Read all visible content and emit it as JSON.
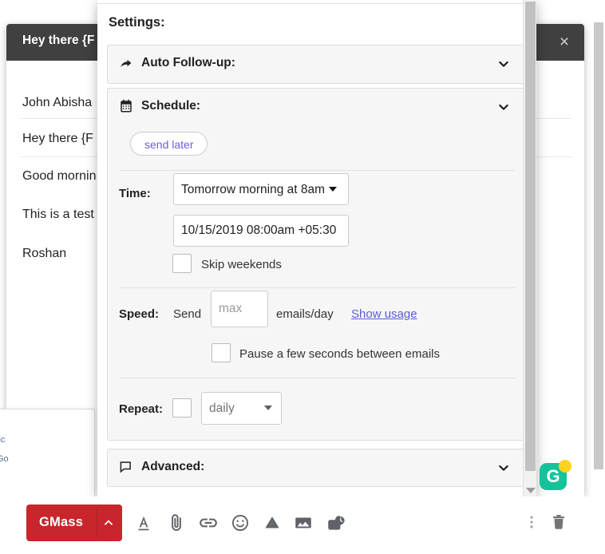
{
  "compose": {
    "subject": "Hey there {F",
    "close_label": "×",
    "rows": [
      "John Abisha",
      "Hey there {F",
      "Good mornin",
      "This is a test",
      "Roshan"
    ]
  },
  "left_peek": {
    "lines": [
      "lic",
      "Go"
    ]
  },
  "settings": {
    "title": "Settings:",
    "sections": {
      "auto_followup": {
        "label": "Auto Follow-up:",
        "icon": "forward-arrow-icon",
        "chevron": "chevron-down-icon"
      },
      "schedule": {
        "label": "Schedule:",
        "icon": "calendar-icon",
        "chevron": "chevron-down-icon",
        "pill_label": "send later",
        "time_label": "Time:",
        "time_selected": "Tomorrow morning at 8am",
        "datetime_value": "10/15/2019 08:00am +05:30",
        "skip_weekends_label": "Skip weekends",
        "speed_label": "Speed:",
        "send_word": "Send",
        "speed_placeholder": "max",
        "emails_per_day_label": "emails/day",
        "show_usage_label": "Show usage",
        "pause_label": "Pause a few seconds between emails",
        "repeat_label": "Repeat:",
        "repeat_selected": "daily"
      },
      "advanced": {
        "label": "Advanced:",
        "icon": "comment-icon",
        "chevron": "chevron-down-icon"
      }
    }
  },
  "toolbar": {
    "gmass_label": "GMass",
    "caret": "caret-up-icon",
    "icons": [
      "text-format-icon",
      "attach-file-icon",
      "insert-link-icon",
      "insert-emoji-icon",
      "google-drive-icon",
      "insert-photo-icon",
      "schedule-send-icon"
    ],
    "right_icons": [
      "more-options-icon",
      "discard-draft-icon"
    ]
  },
  "extension_badge": {
    "letter": "G"
  },
  "colors": {
    "gmass_red": "#c8262c",
    "link_purple": "#5b5bd6",
    "pill_purple": "#6b5ce7",
    "badge_teal": "#15c39a",
    "badge_dot": "#ffd21e"
  }
}
